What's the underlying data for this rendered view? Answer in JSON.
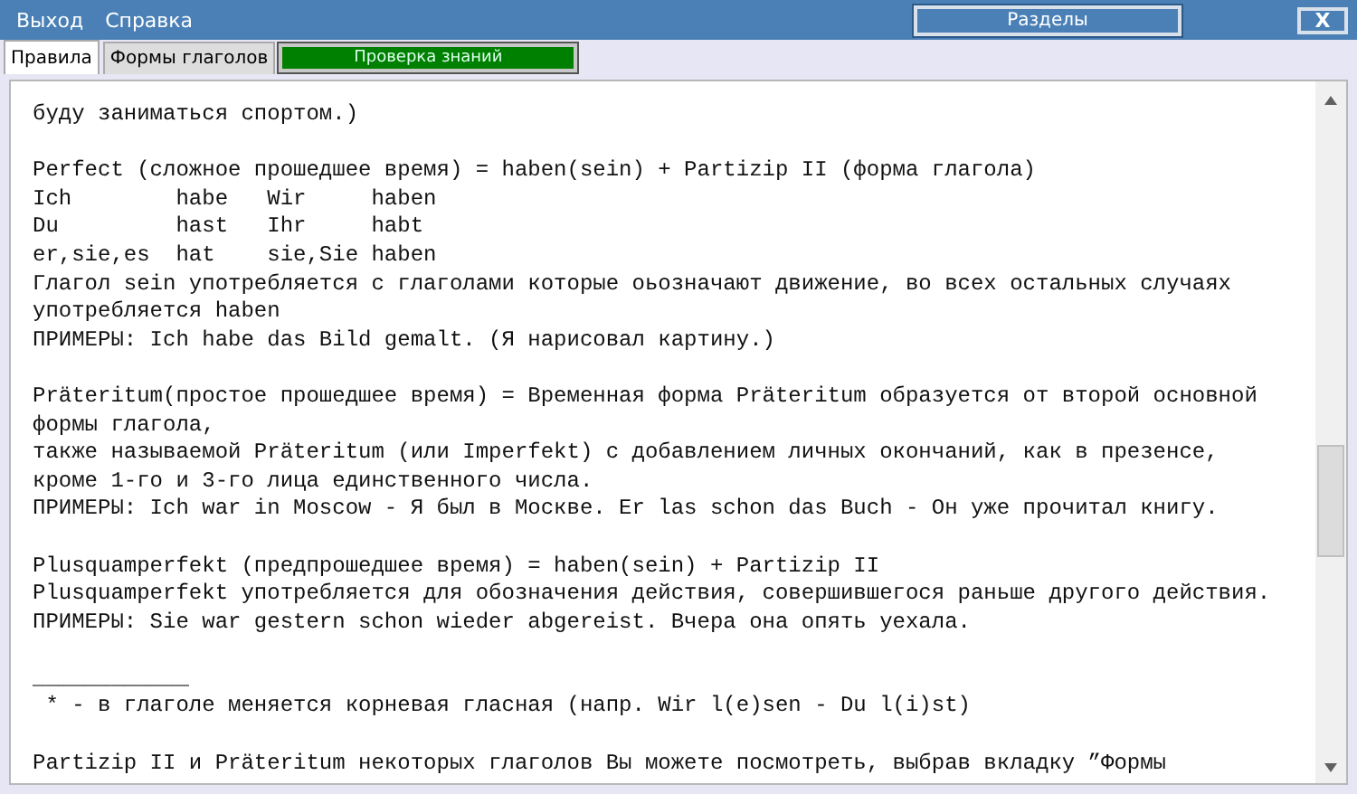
{
  "menu": [
    {
      "label": "Выход"
    },
    {
      "label": "Справка"
    }
  ],
  "sections_button": "Разделы",
  "close_button": "X",
  "tabs": [
    {
      "label": "Правила",
      "selected": true,
      "kind": "tab"
    },
    {
      "label": "Формы глаголов",
      "selected": false,
      "kind": "tab"
    },
    {
      "label": "Проверка знаний",
      "selected": false,
      "kind": "action"
    }
  ],
  "text_paragraphs": [
    {
      "lines": [
        "буду заниматься спортом.)"
      ]
    },
    {
      "lines": [
        "Perfect (сложное прошедшее время) = haben(sein) + Partizip II (форма глагола)",
        "Ich        habe   Wir     haben",
        "Du         hast   Ihr     habt",
        "er,sie,es  hat    sie,Sie haben",
        "Глагол sein употребляется с глаголами которые оьозначают движение, во всех остальных случаях",
        "употребляется haben",
        "ПРИМЕРЫ: Ich habe das Bild gemalt. (Я нарисовал картину.)"
      ]
    },
    {
      "lines": [
        "Präteritum(простое прошедшее время) = Временная форма Präteritum образуется от второй основной",
        "формы глагола,",
        "также называемой Präteritum (или Imperfekt) с добавлением личных окончаний, как в презенсе,",
        "кроме 1-го и 3-го лица единственного числа.",
        "ПРИМЕРЫ: Ich war in Moscow - Я был в Москве. Er las schon das Buch - Он уже прочитал книгу."
      ]
    },
    {
      "lines": [
        "Plusquamperfekt (предпрошедшее время) = haben(sein) + Partizip II",
        "Plusquamperfekt употребляется для обозначения действия, совершившегося раньше другого действия.",
        "ПРИМЕРЫ: Sie war gestern schon wieder abgereist. Вчера она опять уехала."
      ]
    },
    {
      "lines": [
        "____________",
        " * - в глаголе меняется корневая гласная (напр. Wir l(e)sen - Du l(i)st)"
      ]
    },
    {
      "lines": [
        "Partizip II и Präteritum некоторых глаголов Вы можете посмотреть, выбрав вкладку ”Формы"
      ]
    }
  ]
}
